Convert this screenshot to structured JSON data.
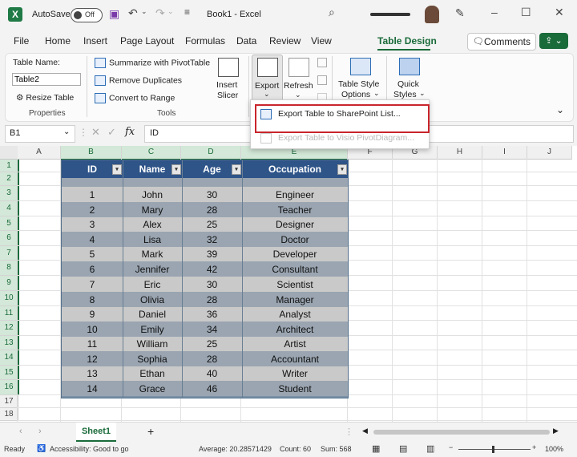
{
  "titlebar": {
    "autosave_label": "AutoSave",
    "autosave_state": "Off",
    "doc_title": "Book1 - Excel",
    "window_controls": [
      "minimize-icon",
      "maximize-icon",
      "close-icon"
    ]
  },
  "tabs": [
    {
      "label": "File"
    },
    {
      "label": "Home"
    },
    {
      "label": "Insert"
    },
    {
      "label": "Page Layout"
    },
    {
      "label": "Formulas"
    },
    {
      "label": "Data"
    },
    {
      "label": "Review"
    },
    {
      "label": "View"
    },
    {
      "label": "Table Design",
      "active": true
    }
  ],
  "comments_label": "Comments",
  "ribbon": {
    "table_name_label": "Table Name:",
    "table_name_value": "Table2",
    "resize_table": "Resize Table",
    "group_properties": "Properties",
    "summarize_pivot": "Summarize with PivotTable",
    "remove_duplicates": "Remove Duplicates",
    "convert_to_range": "Convert to Range",
    "group_tools": "Tools",
    "insert_slicer_1": "Insert",
    "insert_slicer_2": "Slicer",
    "export": "Export",
    "refresh": "Refresh",
    "table_style_1": "Table Style",
    "table_style_2": "Options",
    "quick_styles_1": "Quick",
    "quick_styles_2": "Styles"
  },
  "export_menu": {
    "item1": "Export Table to SharePoint List...",
    "item2": "Export Table to Visio PivotDiagram..."
  },
  "formula_bar": {
    "name_box": "B1",
    "fx": "fx",
    "content": "ID"
  },
  "columns": [
    "A",
    "B",
    "C",
    "D",
    "E",
    "F",
    "G",
    "H",
    "I",
    "J"
  ],
  "rows": [
    "1",
    "2",
    "3",
    "4",
    "5",
    "6",
    "7",
    "8",
    "9",
    "10",
    "11",
    "12",
    "13",
    "14",
    "15",
    "16",
    "17",
    "18"
  ],
  "table": {
    "headers": [
      "ID",
      "Name",
      "Age",
      "Occupation"
    ],
    "rows": [
      [
        "1",
        "John",
        "30",
        "Engineer"
      ],
      [
        "2",
        "Mary",
        "28",
        "Teacher"
      ],
      [
        "3",
        "Alex",
        "25",
        "Designer"
      ],
      [
        "4",
        "Lisa",
        "32",
        "Doctor"
      ],
      [
        "5",
        "Mark",
        "39",
        "Developer"
      ],
      [
        "6",
        "Jennifer",
        "42",
        "Consultant"
      ],
      [
        "7",
        "Eric",
        "30",
        "Scientist"
      ],
      [
        "8",
        "Olivia",
        "28",
        "Manager"
      ],
      [
        "9",
        "Daniel",
        "36",
        "Analyst"
      ],
      [
        "10",
        "Emily",
        "34",
        "Architect"
      ],
      [
        "11",
        "William",
        "25",
        "Artist"
      ],
      [
        "12",
        "Sophia",
        "28",
        "Accountant"
      ],
      [
        "13",
        "Ethan",
        "40",
        "Writer"
      ],
      [
        "14",
        "Grace",
        "46",
        "Student"
      ]
    ],
    "header_color": "#2e5488",
    "band_light": "#c9c9c9",
    "band_dark": "#9aa5b1"
  },
  "sheet_tab": "Sheet1",
  "status": {
    "ready": "Ready",
    "accessibility": "Accessibility: Good to go",
    "average": "Average: 20.28571429",
    "count": "Count: 60",
    "sum": "Sum: 568",
    "zoom": "100%"
  },
  "accent_color": "#1a6b3a"
}
